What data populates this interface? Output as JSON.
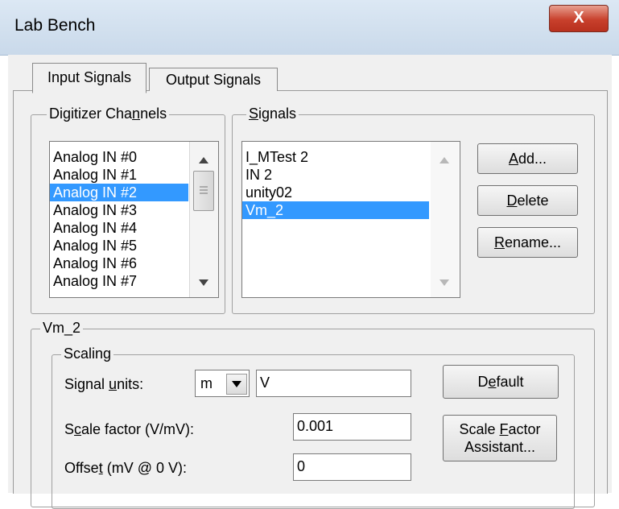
{
  "window": {
    "title": "Lab Bench",
    "close_glyph": "X"
  },
  "tabs": [
    {
      "label": "Input Signals",
      "active": true
    },
    {
      "label": "Output Signals",
      "active": false
    }
  ],
  "digitizer": {
    "legend_pre": "Digitizer Cha",
    "legend_mn": "n",
    "legend_post": "nels",
    "channels": [
      "Analog IN #0",
      "Analog IN #1",
      "Analog IN #2",
      "Analog IN #3",
      "Analog IN #4",
      "Analog IN #5",
      "Analog IN #6",
      "Analog IN #7"
    ],
    "selected_index": 2
  },
  "signals": {
    "legend_pre": "",
    "legend_mn": "S",
    "legend_post": "ignals",
    "items": [
      "I_MTest 2",
      "IN 2",
      "unity02",
      "Vm_2"
    ],
    "selected_index": 3
  },
  "buttons": {
    "add": {
      "pre": "",
      "mn": "A",
      "post": "dd..."
    },
    "delete": {
      "pre": "",
      "mn": "D",
      "post": "elete"
    },
    "rename": {
      "pre": "",
      "mn": "R",
      "post": "ename..."
    },
    "default": {
      "pre": "D",
      "mn": "e",
      "post": "fault"
    },
    "assistant": {
      "line1_pre": "Scale ",
      "line1_mn": "F",
      "line1_post": "actor",
      "line2": "Assistant..."
    }
  },
  "selected_signal": {
    "legend": "Vm_2",
    "scaling_legend": "Scaling",
    "units_label": {
      "pre": "Signal ",
      "mn": "u",
      "post": "nits:"
    },
    "units_prefix": "m",
    "units_value": "V",
    "scale_label": {
      "pre": "S",
      "mn": "c",
      "post": "ale factor (V/mV):"
    },
    "scale_value": "0.001",
    "offset_label": {
      "pre": "Offse",
      "mn": "t",
      "post": " (mV @ 0 V):"
    },
    "offset_value": "0"
  },
  "colors": {
    "selection": "#3399ff",
    "close_button": "#c8402c",
    "face": "#f0f0f0"
  }
}
